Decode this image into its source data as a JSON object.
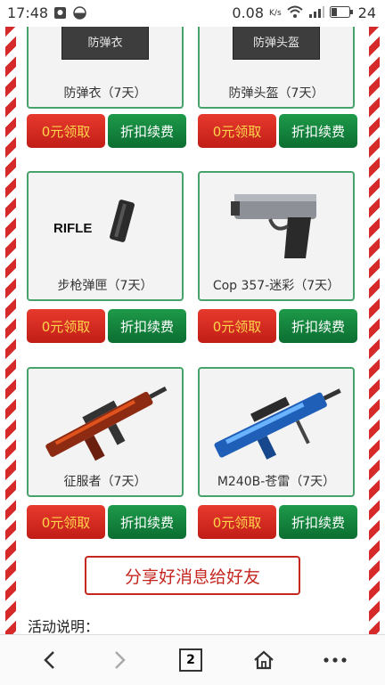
{
  "status": {
    "time": "17:48",
    "speed": "0.08",
    "speed_unit": "K/s",
    "battery": "24"
  },
  "cards": [
    {
      "name": "防弹衣（7天）",
      "image_text": "防弹衣",
      "claim": "0元领取",
      "renew": "折扣续费"
    },
    {
      "name": "防弹头盔（7天）",
      "image_text": "防弹头盔",
      "claim": "0元领取",
      "renew": "折扣续费"
    },
    {
      "name": "步枪弹匣（7天）",
      "image_text": "RIFLE",
      "claim": "0元领取",
      "renew": "折扣续费"
    },
    {
      "name": "Cop 357-迷彩（7天）",
      "claim": "0元领取",
      "renew": "折扣续费"
    },
    {
      "name": "征服者（7天）",
      "claim": "0元领取",
      "renew": "折扣续费"
    },
    {
      "name": "M240B-苍雷（7天）",
      "claim": "0元领取",
      "renew": "折扣续费"
    }
  ],
  "share_button": "分享好消息给好友",
  "description_label": "活动说明：",
  "nav": {
    "tab_count": "2",
    "back_icon": "back-arrow-icon",
    "forward_icon": "forward-arrow-icon",
    "home_icon": "home-icon",
    "more_icon": "more-icon"
  },
  "colors": {
    "claim_button": "#d62a22",
    "claim_text": "#ffd34a",
    "renew_button": "#128040",
    "card_border": "#46a36a",
    "share_border": "#c5261f"
  }
}
